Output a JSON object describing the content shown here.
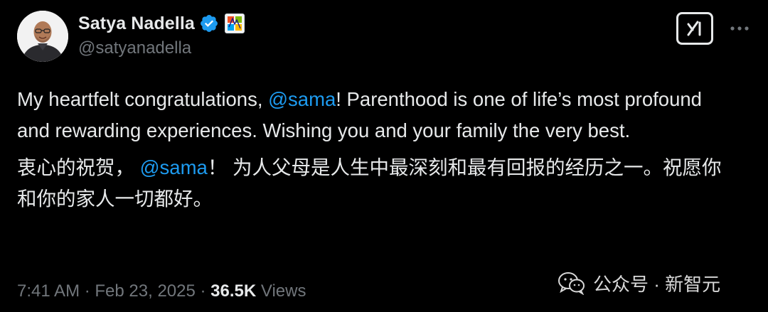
{
  "author": {
    "display_name": "Satya Nadella",
    "handle": "@satyanadella"
  },
  "icons": {
    "verified": "verified-badge-icon",
    "affiliate": "microsoft-affiliate-icon",
    "grok": "grok-icon",
    "more": "more-options-icon",
    "watermark": "wechat-icon"
  },
  "colors": {
    "background": "#000000",
    "text": "#e7e9ea",
    "secondary": "#71767b",
    "mention": "#1d9bf0",
    "verified": "#1d9bf0"
  },
  "tweet": {
    "en_part1": "My heartfelt congratulations, ",
    "en_mention": "@sama",
    "en_part2": "! Parenthood is one of life’s most profound and rewarding experiences. Wishing you and your family the very best.",
    "zh_part1": "衷心的祝贺， ",
    "zh_mention": "@sama",
    "zh_part2": "！ 为人父母是人生中最深刻和最有回报的经历之一。祝愿你和你的家人一切都好。"
  },
  "meta": {
    "time": "7:41 AM",
    "sep1": " · ",
    "date": "Feb 23, 2025",
    "sep2": " · ",
    "views_count": "36.5K",
    "views_label": " Views"
  },
  "watermark": {
    "text": "公众号 · 新智元"
  }
}
